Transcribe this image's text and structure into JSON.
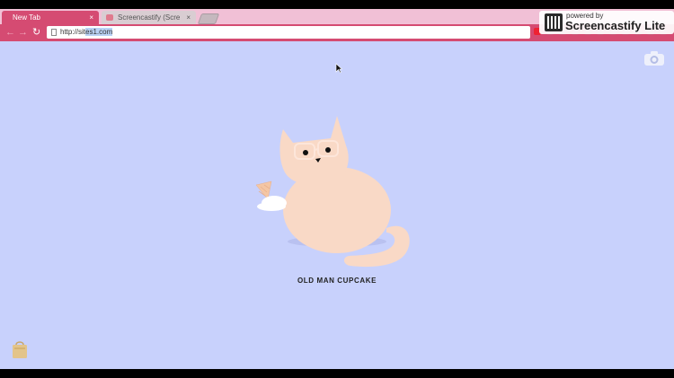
{
  "browser": {
    "tabs": [
      {
        "label": "New Tab",
        "close": "×"
      },
      {
        "label": "Screencastify (Scre",
        "close": "×"
      }
    ],
    "url_prefix": "http://sit",
    "url_highlight": "es1.com",
    "back": "←",
    "forward": "→",
    "reload": "↻"
  },
  "watermark": {
    "small": "powered by",
    "big": "Screencastify Lite"
  },
  "page": {
    "title": "OLD MAN CUPCAKE",
    "background_color": "#c8d1fc",
    "cat_color": "#f9d9c6"
  },
  "icons": {
    "camera": "camera-icon",
    "bag": "shopping-bag-icon",
    "cursor": "mouse-cursor-icon"
  }
}
